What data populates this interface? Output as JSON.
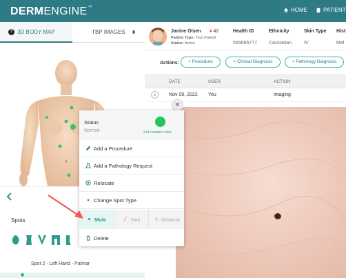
{
  "brand": {
    "bold": "DERM",
    "light": "ENGINE",
    "mark": "™"
  },
  "topnav": {
    "home": "HOME",
    "patients": "PATIENTS"
  },
  "left_tabs": [
    "3D BODY MAP",
    "TBP IMAGES"
  ],
  "spots": {
    "label": "Spots",
    "caption": "Spot 2 - Left Hand - Palmar"
  },
  "patient": {
    "name": "Janine Olsen",
    "alert_count": "42",
    "type_label": "Patient Type:",
    "type_value": "Your Patient",
    "status_label": "Status:",
    "status_value": "Active",
    "columns": [
      {
        "header": "Health ID",
        "value": "555666777"
      },
      {
        "header": "Ethnicity",
        "value": "Caucasian"
      },
      {
        "header": "Skin Type",
        "value": "IV"
      },
      {
        "header": "Hist",
        "value": "Mel"
      }
    ]
  },
  "actions": {
    "label": "Actions:",
    "buttons": [
      "+ Procedure",
      "+ Clinical Diagnosis",
      "+ Pathology Diagnosis"
    ]
  },
  "table": {
    "headers": [
      "DATE",
      "USER",
      "ACTION"
    ],
    "rows": [
      {
        "date": "Nov 09, 2022",
        "user": "You",
        "action": "Imaging"
      }
    ]
  },
  "menu": {
    "status_title": "Status",
    "status_value": "Normal",
    "status_color": "#22c55e",
    "set_color_link": "Set custom color",
    "items": [
      "Add a Procedure",
      "Add a Pathology Request",
      "Relocate",
      "Change Spot Type"
    ],
    "spot_types": [
      "Mole",
      "Hair",
      "General"
    ],
    "selected_type": "Mole",
    "delete": "Delete"
  },
  "colors": {
    "brand": "#2e7a85",
    "accent": "#2ab7a9",
    "arrow": "#f05a4f"
  }
}
